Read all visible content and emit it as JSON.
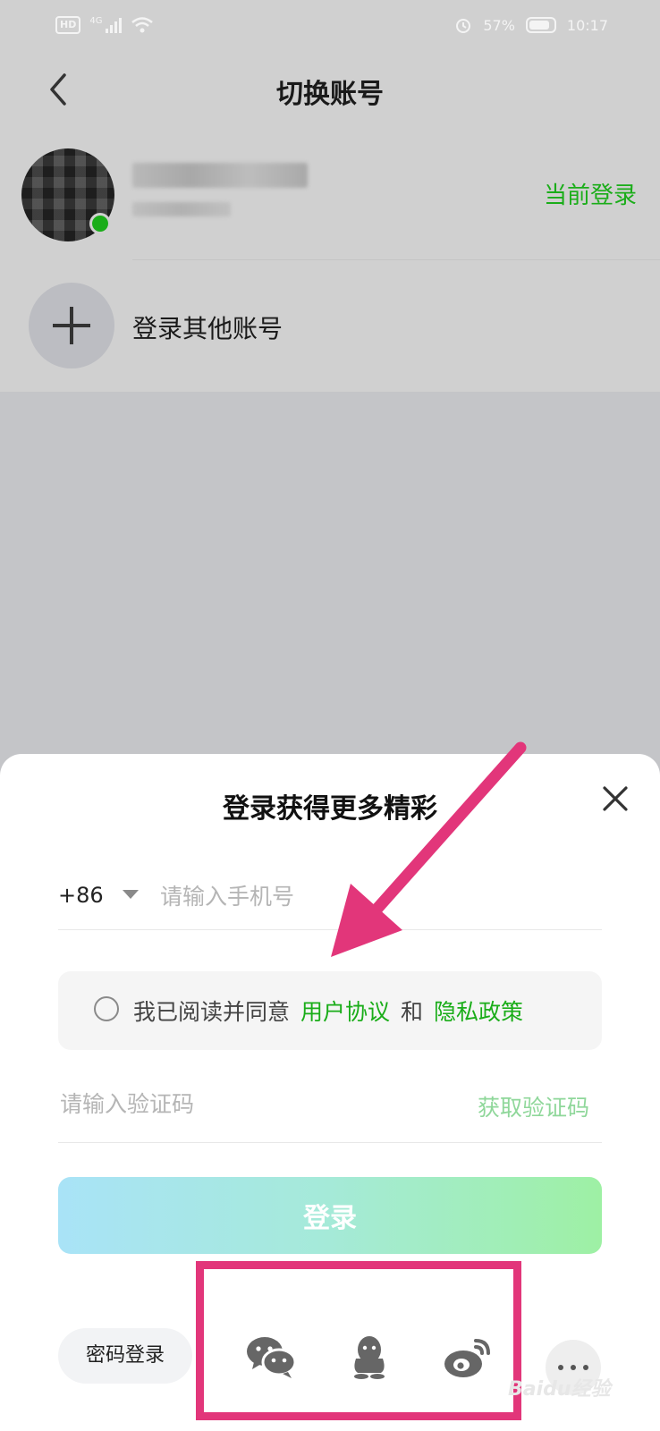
{
  "status_bar": {
    "network_badge": "HD",
    "network_type": "4G",
    "battery_percent": "57%",
    "time": "10:17",
    "icons": [
      "hd-icon",
      "signal-icon",
      "wifi-icon",
      "alarm-icon",
      "battery-icon"
    ]
  },
  "header": {
    "title": "切换账号",
    "back_icon": "chevron-left-icon"
  },
  "current_account": {
    "status_label": "当前登录",
    "online_color": "#1aad19"
  },
  "add_account": {
    "label": "登录其他账号",
    "icon": "plus-icon"
  },
  "login_sheet": {
    "title": "登录获得更多精彩",
    "close_icon": "close-icon",
    "country_code": "+86",
    "phone_placeholder": "请输入手机号",
    "agreement": {
      "prefix": "我已阅读并同意",
      "user_agreement": "用户协议",
      "connector": "和",
      "privacy_policy": "隐私政策"
    },
    "code_placeholder": "请输入验证码",
    "get_code_label": "获取验证码",
    "login_button": "登录",
    "password_login": "密码登录",
    "social_logins": [
      "wechat-icon",
      "qq-icon",
      "weibo-icon"
    ],
    "more_icon": "more-icon"
  },
  "colors": {
    "accent": "#1aad19",
    "annotation": "#e2367a"
  },
  "watermark": "Baidu经验"
}
